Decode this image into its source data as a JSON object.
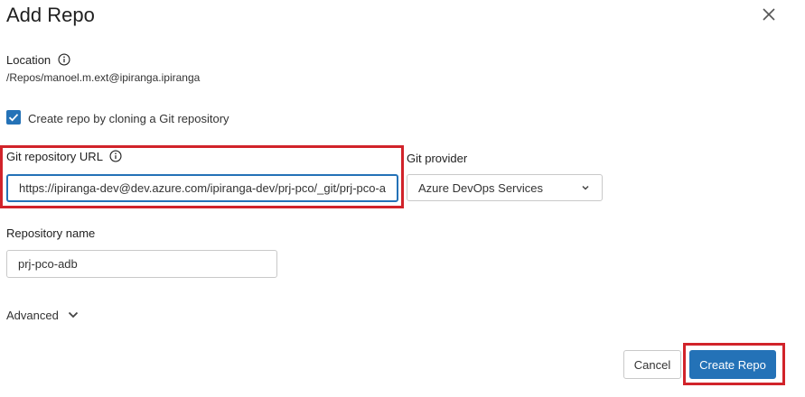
{
  "dialog": {
    "title": "Add Repo",
    "close_icon": "close-icon"
  },
  "location": {
    "label": "Location",
    "info_icon": "info-icon",
    "path": "/Repos/manoel.m.ext@ipiranga.ipiranga"
  },
  "clone": {
    "checked": true,
    "label": "Create repo by cloning a Git repository"
  },
  "git_url": {
    "label": "Git repository URL",
    "info_icon": "info-icon",
    "value": "https://ipiranga-dev@dev.azure.com/ipiranga-dev/prj-pco/_git/prj-pco-adb"
  },
  "git_provider": {
    "label": "Git provider",
    "selected": "Azure DevOps Services"
  },
  "repo_name": {
    "label": "Repository name",
    "value": "prj-pco-adb"
  },
  "advanced": {
    "label": "Advanced"
  },
  "footer": {
    "cancel_label": "Cancel",
    "create_label": "Create Repo"
  },
  "colors": {
    "primary": "#2472b7",
    "highlight": "#d1232a"
  }
}
